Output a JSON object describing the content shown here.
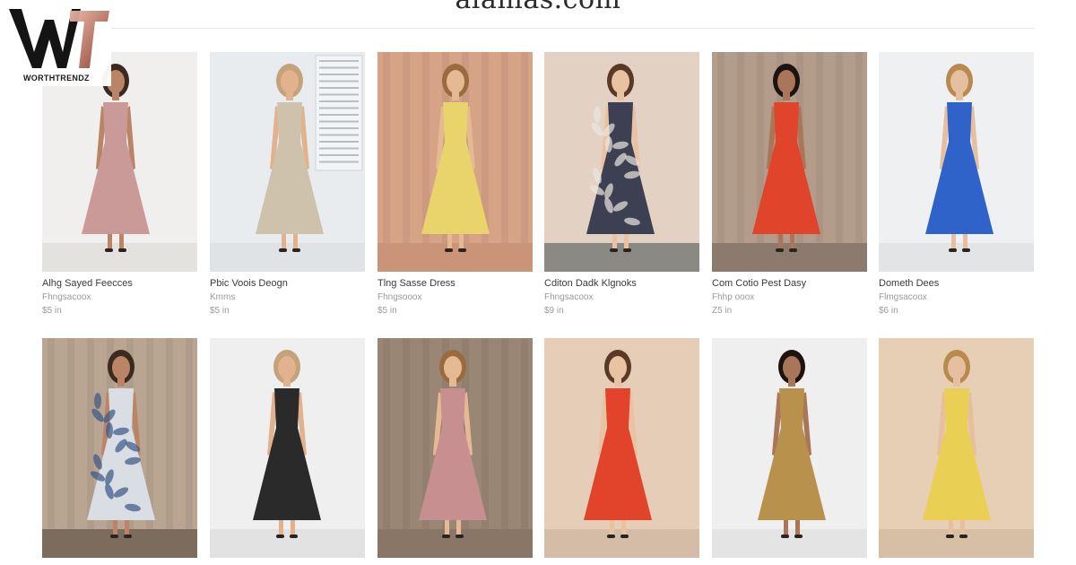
{
  "site": {
    "title": "alamas.com",
    "logo_text": "WORTHTRENDZ",
    "logo_letters": "WT",
    "accent": "#c98a7a"
  },
  "products": [
    {
      "name": "Alhg Sayed Feecces",
      "subtitle": "Fhngsacoox",
      "price": "$5 in",
      "dress_color": "#c99a98",
      "bg_color": "#f0efee",
      "floor_color": "#e4e2df",
      "icon": "pink-sleeveless-dress-photo"
    },
    {
      "name": "Pbic Voois Deogn",
      "subtitle": "Kmms",
      "price": "$5 in",
      "dress_color": "#cfc2ad",
      "bg_color": "#e9ecef",
      "floor_color": "#dfe3e6",
      "icon": "beige-halter-dress-photo"
    },
    {
      "name": "Tlng Sasse Dress",
      "subtitle": "Fhngsooox",
      "price": "$5 in",
      "dress_color": "#e8d46a",
      "bg_color": "#d6a387",
      "floor_color": "#c99478",
      "icon": "yellow-maxi-dress-photo"
    },
    {
      "name": "Cditon Dadk Klgnoks",
      "subtitle": "Fhngsacoox",
      "price": "$9 in",
      "dress_color": "#3c4052",
      "bg_color": "#e3d2c3",
      "floor_color": "#8b8984",
      "icon": "navy-print-dress-photo"
    },
    {
      "name": "Com Cotio Pest Dasy",
      "subtitle": "Fhhp ooox",
      "price": "Z5 in",
      "dress_color": "#e0442a",
      "bg_color": "#b49c8b",
      "floor_color": "#8c7a6e",
      "icon": "red-maxi-dress-photo"
    },
    {
      "name": "Dometh Dees",
      "subtitle": "Flmgsacoox",
      "price": "$6 in",
      "dress_color": "#2f63c9",
      "bg_color": "#eff0f2",
      "floor_color": "#e3e4e6",
      "icon": "blue-maxi-dress-photo"
    },
    {
      "name": "",
      "subtitle": "",
      "price": "",
      "dress_color": "#d9dde4",
      "bg_color": "#b9a591",
      "floor_color": "#7c6c5e",
      "icon": "blue-print-sundress-photo"
    },
    {
      "name": "",
      "subtitle": "",
      "price": "",
      "dress_color": "#2a2a2a",
      "bg_color": "#efefef",
      "floor_color": "#e2e2e2",
      "icon": "black-jumpsuit-photo"
    },
    {
      "name": "",
      "subtitle": "",
      "price": "",
      "dress_color": "#c78f8f",
      "bg_color": "#9a8674",
      "floor_color": "#8a7666",
      "icon": "pink-ruffle-dress-photo"
    },
    {
      "name": "",
      "subtitle": "",
      "price": "",
      "dress_color": "#e2432b",
      "bg_color": "#e5cdb7",
      "floor_color": "#d4bca6",
      "icon": "red-halter-dress-photo"
    },
    {
      "name": "",
      "subtitle": "",
      "price": "",
      "dress_color": "#b8914c",
      "bg_color": "#efefef",
      "floor_color": "#e4e4e4",
      "icon": "mustard-maxi-dress-photo"
    },
    {
      "name": "",
      "subtitle": "",
      "price": "",
      "dress_color": "#eacf55",
      "bg_color": "#e6cfb4",
      "floor_color": "#d6bfa4",
      "icon": "yellow-ruffle-dress-photo"
    }
  ]
}
